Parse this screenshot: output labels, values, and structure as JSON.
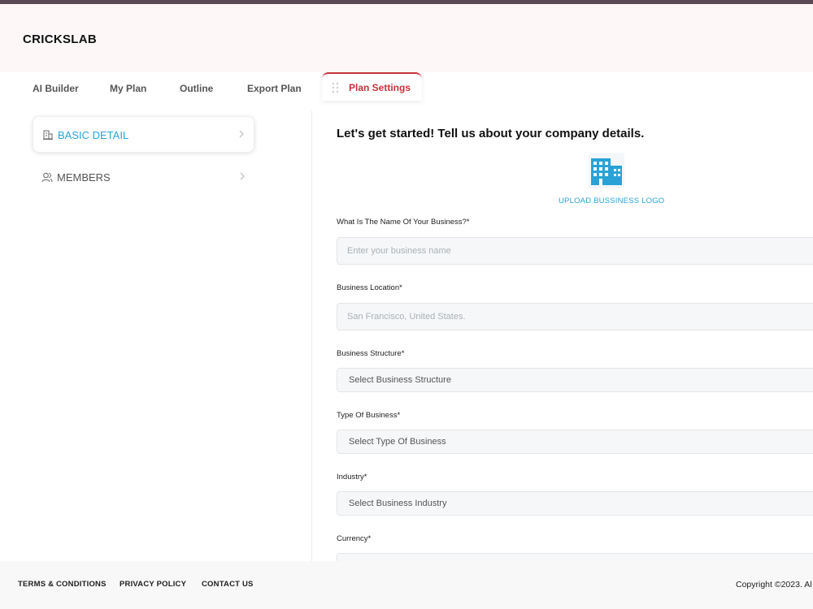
{
  "app": {
    "brand": "CRICKSLAB"
  },
  "tabs": [
    {
      "label": "AI Builder"
    },
    {
      "label": "My Plan"
    },
    {
      "label": "Outline"
    },
    {
      "label": "Export Plan"
    },
    {
      "label": "Plan Settings",
      "active": true
    }
  ],
  "sidebar": {
    "items": [
      {
        "label": "BASIC DETAIL",
        "icon": "building-icon",
        "active": true
      },
      {
        "label": "MEMBERS",
        "icon": "users-icon",
        "active": false
      }
    ]
  },
  "main": {
    "title": "Let's get started! Tell us about your company details.",
    "upload_logo_label": "UPLOAD BUSSINESS LOGO",
    "fields": {
      "business_name": {
        "label": "What Is The Name Of Your Business?*",
        "placeholder": "Enter your business name",
        "value": ""
      },
      "location": {
        "label": "Business Location*",
        "placeholder": "San Francisco, United States.",
        "value": ""
      },
      "structure": {
        "label": "Business Structure*",
        "value": "Select Business Structure"
      },
      "type": {
        "label": "Type Of Business*",
        "value": "Select Type Of Business"
      },
      "industry": {
        "label": "Industry*",
        "value": "Select Business Industry"
      },
      "currency": {
        "label": "Currency*",
        "value": ""
      }
    }
  },
  "footer": {
    "links": [
      "TERMS & CONDITIONS",
      "PRIVACY POLICY",
      "CONTACT US"
    ],
    "copyright": "Copyright ©2023. Al"
  },
  "colors": {
    "accent": "#2aa2d6",
    "active_tab": "#c8323a"
  }
}
